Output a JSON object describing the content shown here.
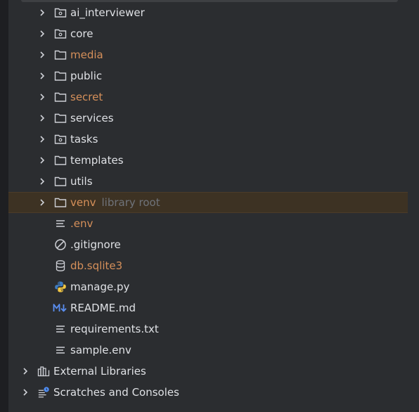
{
  "project_tree": {
    "items": [
      {
        "label": "ai_interviewer",
        "kind": "package",
        "excluded": false
      },
      {
        "label": "core",
        "kind": "package",
        "excluded": false
      },
      {
        "label": "media",
        "kind": "folder",
        "excluded": true
      },
      {
        "label": "public",
        "kind": "folder",
        "excluded": false
      },
      {
        "label": "secret",
        "kind": "folder",
        "excluded": true
      },
      {
        "label": "services",
        "kind": "folder",
        "excluded": false
      },
      {
        "label": "tasks",
        "kind": "package",
        "excluded": false
      },
      {
        "label": "templates",
        "kind": "folder",
        "excluded": false
      },
      {
        "label": "utils",
        "kind": "folder",
        "excluded": false
      },
      {
        "label": "venv",
        "hint": "library root",
        "kind": "folder",
        "excluded": true,
        "selected": true
      },
      {
        "label": ".env",
        "kind": "text-file",
        "excluded": true
      },
      {
        "label": ".gitignore",
        "kind": "ignore-file",
        "excluded": false
      },
      {
        "label": "db.sqlite3",
        "kind": "database-file",
        "excluded": true
      },
      {
        "label": "manage.py",
        "kind": "python-file",
        "excluded": false
      },
      {
        "label": "README.md",
        "kind": "markdown-file",
        "excluded": false
      },
      {
        "label": "requirements.txt",
        "kind": "text-file",
        "excluded": false
      },
      {
        "label": "sample.env",
        "kind": "text-file",
        "excluded": false
      }
    ],
    "root_items": [
      {
        "label": "External Libraries",
        "kind": "library"
      },
      {
        "label": "Scratches and Consoles",
        "kind": "scratches"
      }
    ]
  },
  "colors": {
    "background": "#2b2d30",
    "text": "#dfe1e5",
    "excluded_text": "#d6905a",
    "hint_text": "#6f737a",
    "selection": "#3d3223"
  },
  "icons": {
    "chevron": "chevron-right-icon",
    "folder": "folder-icon",
    "package": "package-folder-icon",
    "text_file": "text-file-icon",
    "ignore_file": "ignore-file-icon",
    "database_file": "database-icon",
    "python_file": "python-icon",
    "markdown_file": "markdown-icon",
    "library": "library-icon",
    "scratches": "scratches-icon"
  }
}
